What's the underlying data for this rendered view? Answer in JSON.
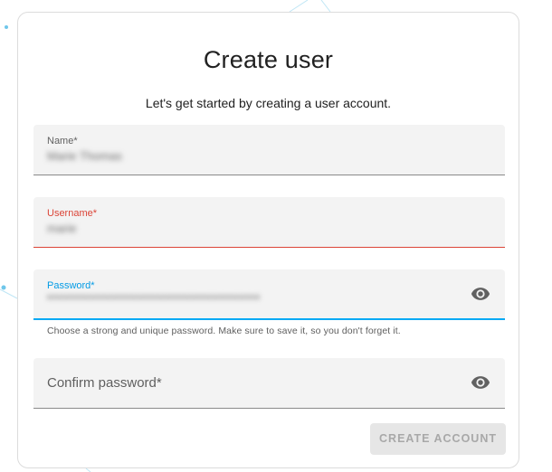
{
  "dialog": {
    "title": "Create user",
    "subtitle": "Let's get started by creating a user account."
  },
  "fields": {
    "name": {
      "label": "Name*",
      "value": "Marie Thomas",
      "state": "normal"
    },
    "username": {
      "label": "Username*",
      "value": "marie",
      "state": "error"
    },
    "password": {
      "label": "Password*",
      "value": "••••••••••••••••••••••••••••••••••••••••",
      "state": "focused",
      "helper": "Choose a strong and unique password. Make sure to save it, so you don't forget it.",
      "icon": "eye-icon"
    },
    "confirm_password": {
      "label": "Confirm password*",
      "state": "normal",
      "icon": "eye-icon"
    }
  },
  "actions": {
    "create_label": "CREATE ACCOUNT",
    "create_disabled": true
  },
  "colors": {
    "error": "#db4437",
    "focus": "#03a9f4",
    "field_bg": "#f3f3f3"
  }
}
